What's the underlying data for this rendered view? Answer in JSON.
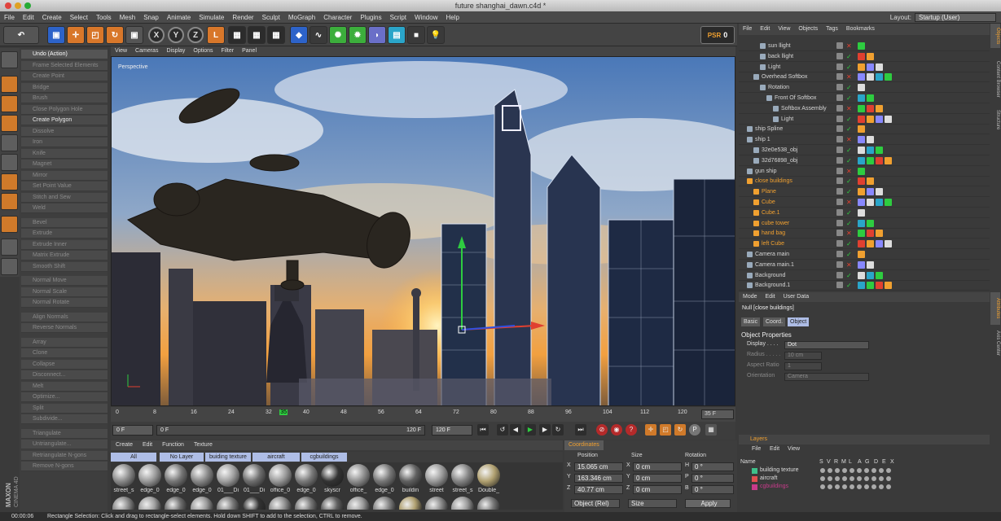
{
  "window": {
    "title": "future shanghai_dawn.c4d *"
  },
  "menu": [
    "File",
    "Edit",
    "Create",
    "Select",
    "Tools",
    "Mesh",
    "Snap",
    "Animate",
    "Simulate",
    "Render",
    "Sculpt",
    "MoGraph",
    "Character",
    "Plugins",
    "Script",
    "Window",
    "Help"
  ],
  "layout": {
    "label": "Layout:",
    "value": "Startup (User)"
  },
  "toolbar": {
    "x": "X",
    "y": "Y",
    "z": "Z",
    "psr_label": "PSR",
    "psr_value": "0"
  },
  "commands": [
    {
      "label": "Undo (Action)",
      "state": "hl"
    },
    {
      "label": "Frame Selected Elements",
      "state": "off"
    },
    {
      "label": "Create Point",
      "state": "off"
    },
    {
      "label": "Bridge",
      "state": "off"
    },
    {
      "label": "Brush",
      "state": "off"
    },
    {
      "label": "Close Polygon Hole",
      "state": "off"
    },
    {
      "label": "Create Polygon",
      "state": "on"
    },
    {
      "label": "Dissolve",
      "state": "off"
    },
    {
      "label": "Iron",
      "state": "off"
    },
    {
      "label": "Knife",
      "state": "off"
    },
    {
      "label": "Magnet",
      "state": "off"
    },
    {
      "label": "Mirror",
      "state": "off"
    },
    {
      "label": "Set Point Value",
      "state": "off"
    },
    {
      "label": "Stitch and Sew",
      "state": "off"
    },
    {
      "label": "Weld",
      "state": "off"
    },
    {
      "label": "Bevel",
      "state": "off"
    },
    {
      "label": "Extrude",
      "state": "off"
    },
    {
      "label": "Extrude Inner",
      "state": "off"
    },
    {
      "label": "Matrix Extrude",
      "state": "off"
    },
    {
      "label": "Smooth Shift",
      "state": "off"
    },
    {
      "label": "Normal Move",
      "state": "off"
    },
    {
      "label": "Normal Scale",
      "state": "off"
    },
    {
      "label": "Normal Rotate",
      "state": "off"
    },
    {
      "label": "Align Normals",
      "state": "off"
    },
    {
      "label": "Reverse Normals",
      "state": "off"
    },
    {
      "label": "Array",
      "state": "off"
    },
    {
      "label": "Clone",
      "state": "off"
    },
    {
      "label": "Collapse",
      "state": "off"
    },
    {
      "label": "Disconnect...",
      "state": "off"
    },
    {
      "label": "Melt",
      "state": "off"
    },
    {
      "label": "Optimize...",
      "state": "off"
    },
    {
      "label": "Split",
      "state": "off"
    },
    {
      "label": "Subdivide...",
      "state": "off"
    },
    {
      "label": "Triangulate",
      "state": "off"
    },
    {
      "label": "Untriangulate...",
      "state": "off"
    },
    {
      "label": "Retriangulate N-gons",
      "state": "off"
    },
    {
      "label": "Remove N-gons",
      "state": "off"
    }
  ],
  "viewport": {
    "menu": [
      "View",
      "Cameras",
      "Display",
      "Options",
      "Filter",
      "Panel"
    ],
    "label": "Perspective"
  },
  "timeline": {
    "ticks": [
      "0",
      "8",
      "16",
      "24",
      "32",
      "35",
      "40",
      "48",
      "56",
      "64",
      "72",
      "80",
      "88",
      "96",
      "104",
      "112",
      "120"
    ],
    "current_frame": "35 F"
  },
  "transport": {
    "start": "0 F",
    "min": "0 F",
    "max": "120 F",
    "end": "120 F"
  },
  "materials": {
    "menu": [
      "Create",
      "Edit",
      "Function",
      "Texture"
    ],
    "tabs": [
      "All",
      "No Layer",
      "buiding texture",
      "aircraft",
      "cgbuildings"
    ],
    "items": [
      "street_s",
      "edge_0",
      "edge_0",
      "edge_0",
      "01___Di",
      "01___Di",
      "office_0",
      "edge_0",
      "skyscr",
      "office_",
      "edge_0",
      "buildin",
      "street",
      "street_s",
      "Double_"
    ],
    "colors": [
      "#8a8a8a",
      "#9a9a9a",
      "#777",
      "#888",
      "#a0a0a0",
      "#6e6e6e",
      "#999",
      "#7a7a7a",
      "#333",
      "#8f8f8f",
      "#777",
      "#606060",
      "#9a9a9a",
      "#848484",
      "#b0a070"
    ]
  },
  "coordinates": {
    "tab": "Coordinates",
    "headers": [
      "Position",
      "Size",
      "Rotation"
    ],
    "rows": [
      {
        "axis": "X",
        "pos": "15.065 cm",
        "sax": "X",
        "size": "0 cm",
        "rax": "H",
        "rot": "0 °"
      },
      {
        "axis": "Y",
        "pos": "163.346 cm",
        "sax": "Y",
        "size": "0 cm",
        "rax": "P",
        "rot": "0 °"
      },
      {
        "axis": "Z",
        "pos": "40.77 cm",
        "sax": "Z",
        "size": "0 cm",
        "rax": "B",
        "rot": "0 °"
      }
    ],
    "mode": "Object (Rel)",
    "size_mode": "Size",
    "apply": "Apply"
  },
  "objects": {
    "menu": [
      "File",
      "Edit",
      "View",
      "Objects",
      "Tags",
      "Bookmarks"
    ],
    "rows": [
      {
        "name": "sun llight",
        "indent": 16,
        "orange": false
      },
      {
        "name": "back llight",
        "indent": 16,
        "orange": false
      },
      {
        "name": "Light",
        "indent": 16,
        "orange": false
      },
      {
        "name": "Overhead Softbox",
        "indent": 8,
        "orange": false
      },
      {
        "name": "Rotation",
        "indent": 16,
        "orange": false
      },
      {
        "name": "Front Of Softbox",
        "indent": 24,
        "orange": false
      },
      {
        "name": "Softbox Assembly",
        "indent": 32,
        "orange": false
      },
      {
        "name": "Light",
        "indent": 32,
        "orange": false
      },
      {
        "name": "ship Spline",
        "indent": 0,
        "orange": false
      },
      {
        "name": "ship 1",
        "indent": 0,
        "orange": false
      },
      {
        "name": "32e0e538_obj",
        "indent": 8,
        "orange": false
      },
      {
        "name": "32d76898_obj",
        "indent": 8,
        "orange": false
      },
      {
        "name": "gun ship",
        "indent": 0,
        "orange": false
      },
      {
        "name": "close buildings",
        "indent": 0,
        "orange": true
      },
      {
        "name": "Plane",
        "indent": 8,
        "orange": true
      },
      {
        "name": "Cube",
        "indent": 8,
        "orange": true
      },
      {
        "name": "Cube.1",
        "indent": 8,
        "orange": true
      },
      {
        "name": "cube tower",
        "indent": 8,
        "orange": true
      },
      {
        "name": "hand bag",
        "indent": 8,
        "orange": true
      },
      {
        "name": "left Cube",
        "indent": 8,
        "orange": true
      },
      {
        "name": "Camera main",
        "indent": 0,
        "orange": false
      },
      {
        "name": "Camera main.1",
        "indent": 0,
        "orange": false
      },
      {
        "name": "Background",
        "indent": 0,
        "orange": false
      },
      {
        "name": "Background.1",
        "indent": 0,
        "orange": false
      }
    ]
  },
  "attributes": {
    "menu": [
      "Mode",
      "Edit",
      "User Data"
    ],
    "title": "Null [close buildings]",
    "tabs": [
      "Basic",
      "Coord.",
      "Object"
    ],
    "section": "Object Properties",
    "props": [
      {
        "label": "Display . . . .",
        "value": "Dot"
      },
      {
        "label": "Radius . . . . .",
        "value": "10 cm"
      },
      {
        "label": "Aspect Ratio",
        "value": "1"
      },
      {
        "label": "Orientation",
        "value": "Camera"
      }
    ]
  },
  "layers": {
    "title": "Layers",
    "menu": [
      "File",
      "Edit",
      "View"
    ],
    "headers": [
      "Name",
      "S",
      "V",
      "R",
      "M",
      "L",
      "A",
      "G",
      "D",
      "E",
      "X"
    ],
    "rows": [
      {
        "name": "building texture",
        "color": "#3ec08a"
      },
      {
        "name": "aircraft",
        "color": "#e05050"
      },
      {
        "name": "cgbuildings",
        "color": "#c83a8a"
      }
    ]
  },
  "side_tabs": [
    "Objects",
    "Content Browser",
    "Structure",
    "Attributes",
    "Axis Center"
  ],
  "status": {
    "time": "00:00:06",
    "message": "Rectangle Selection: Click and drag to rectangle-select elements. Hold down SHIFT to add to the selection, CTRL to remove."
  },
  "brand": {
    "line1": "MAXON",
    "line2": "CINEMA 4D"
  }
}
